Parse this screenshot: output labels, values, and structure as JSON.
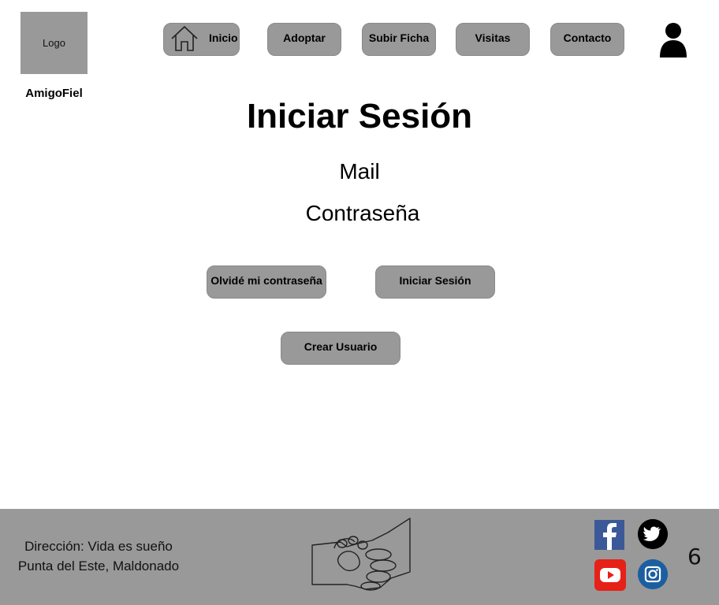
{
  "header": {
    "logo_text": "Logo",
    "brand_name": "AmigoFiel",
    "nav": [
      {
        "label": "Inicio",
        "icon": "home-icon"
      },
      {
        "label": "Adoptar"
      },
      {
        "label": "Subir Ficha"
      },
      {
        "label": "Visitas"
      },
      {
        "label": "Contacto"
      }
    ],
    "user_icon": "user-icon"
  },
  "main": {
    "title": "Iniciar Sesión",
    "mail_label": "Mail",
    "password_label": "Contraseña",
    "forgot_button": "Olvidé mi contraseña",
    "login_button": "Iniciar Sesión",
    "create_button": "Crear Usuario"
  },
  "footer": {
    "address_line1": "Dirección: Vida es sueño",
    "address_line2": "Punta del Este, Maldonado",
    "center_icon": "handshake-paw-icon",
    "social": [
      "facebook-icon",
      "twitter-icon",
      "youtube-icon",
      "instagram-icon"
    ],
    "page_number": "6"
  },
  "colors": {
    "button_gray": "#999999",
    "footer_gray": "#999999",
    "facebook": "#3b5998",
    "youtube": "#e62117",
    "instagram": "#1b5fa0"
  }
}
